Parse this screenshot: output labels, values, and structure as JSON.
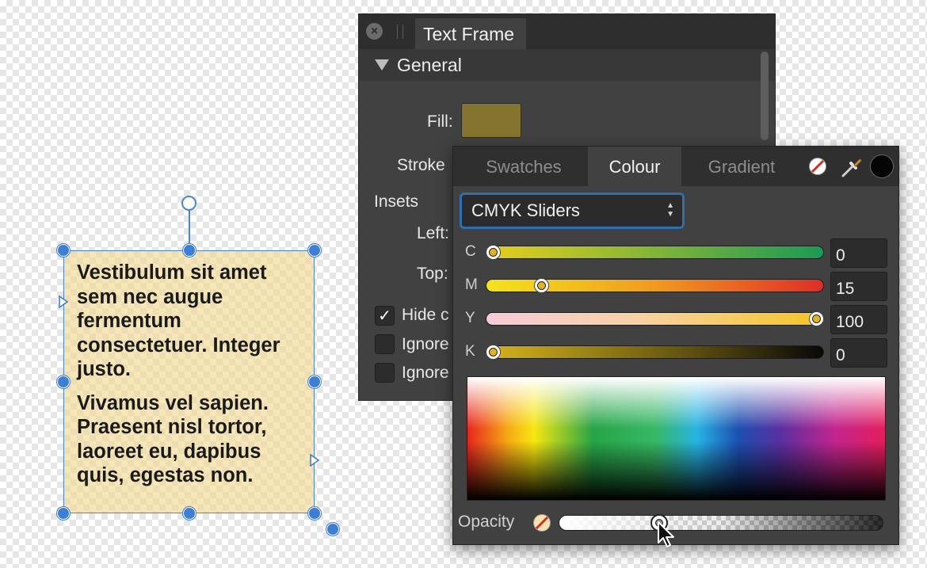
{
  "canvas": {
    "frame_paragraphs": [
      "Vestibulum sit amet sem nec augue fermentum consectetuer. Integer justo.",
      "Vivamus vel sapien. Praesent nisl tortor, laoreet eu, dapibus quis, egestas non."
    ],
    "frame_fill_color": "#f6e6b8",
    "selection_color": "#3d7fd6"
  },
  "text_frame_panel": {
    "tab_label": "Text Frame",
    "close_icon": "close-icon",
    "section_label": "General",
    "fill_label": "Fill:",
    "fill_color": "#84742f",
    "stroke_label": "Stroke",
    "insets_label": "Insets",
    "left_label": "Left:",
    "top_label": "Top:",
    "checkboxes": [
      {
        "label": "Hide c",
        "checked": true
      },
      {
        "label": "Ignore",
        "checked": false
      },
      {
        "label": "Ignore",
        "checked": false
      }
    ]
  },
  "colour_popover": {
    "tabs": [
      {
        "label": "Swatches",
        "active": false
      },
      {
        "label": "Colour",
        "active": true
      },
      {
        "label": "Gradient",
        "active": false
      }
    ],
    "mode_select": {
      "value": "CMYK Sliders"
    },
    "accent_color": "#2f6fb0",
    "sliders": [
      {
        "letter": "C",
        "value": "0",
        "position": 0.0
      },
      {
        "letter": "M",
        "value": "15",
        "position": 0.15
      },
      {
        "letter": "Y",
        "value": "100",
        "position": 1.0
      },
      {
        "letter": "K",
        "value": "0",
        "position": 0.0
      }
    ],
    "opacity_label": "Opacity",
    "opacity_position": 0.3
  }
}
